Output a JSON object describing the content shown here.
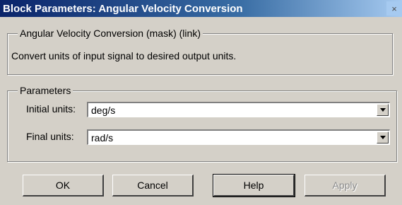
{
  "window": {
    "title": "Block Parameters: Angular Velocity Conversion",
    "close_glyph": "×"
  },
  "description_group": {
    "legend": "Angular Velocity Conversion (mask) (link)",
    "text": "Convert units of input signal to desired output units."
  },
  "parameters": {
    "legend": "Parameters",
    "initial_label": "Initial units:",
    "initial_value": "deg/s",
    "final_label": "Final units:",
    "final_value": "rad/s"
  },
  "buttons": {
    "ok": "OK",
    "cancel": "Cancel",
    "help": "Help",
    "apply": "Apply"
  }
}
